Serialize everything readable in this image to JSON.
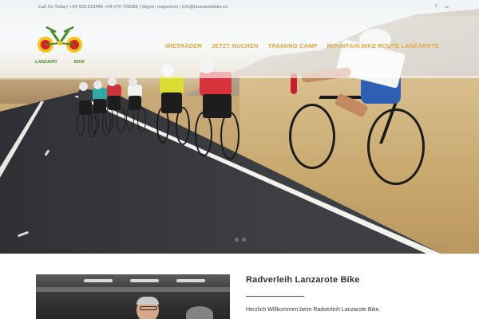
{
  "topbar": {
    "contact": "Call Us Today! +34 928 513489 +34 670 799089 | Skype: miguelcsh | info@lanzarotebike.es",
    "social": [
      {
        "icon": "facebook-icon",
        "glyph": "f"
      },
      {
        "icon": "flickr-icon",
        "glyph": "●●"
      }
    ]
  },
  "logo": {
    "text_left": "LANZARO",
    "text_right": "BIKE"
  },
  "nav": {
    "items": [
      {
        "label": "MIETRÄDER"
      },
      {
        "label": "JETZT BUCHEN"
      },
      {
        "label": "TRAINING CAMP"
      },
      {
        "label": "MOUNTAIN BIKE ROUTE LANZAROTE"
      }
    ]
  },
  "slider": {
    "slide_count": 3,
    "active_slide": 1
  },
  "content": {
    "title": "Radverleih Lanzarote Bike",
    "intro": "Herzlich Willkommen beim Radverleih Lanzarote Bike."
  },
  "colors": {
    "accent": "#e0a83a",
    "logo_green": "#4a8a2a",
    "logo_red": "#d3222a",
    "logo_yellow": "#f0c419"
  }
}
